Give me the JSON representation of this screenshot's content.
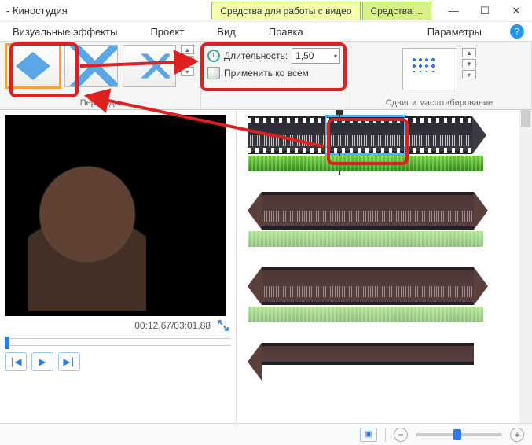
{
  "titlebar": {
    "app_title": "- Киностудия",
    "context_tab_1": "Средства для работы с видео",
    "context_tab_2": "Средства ...",
    "min_glyph": "—",
    "max_glyph": "☐",
    "close_glyph": "✕",
    "help_glyph": "?"
  },
  "menu": {
    "visual_effects": "Визуальные эффекты",
    "project": "Проект",
    "view": "Вид",
    "edit": "Правка",
    "params": "Параметры"
  },
  "ribbon": {
    "transitions_label": "Переходы",
    "duration_label": "Длительность:",
    "duration_value": "1,50",
    "apply_all_label": "Применить ко всем",
    "panzoom_label": "Сдвиг и масштабирование",
    "updown_up": "▲",
    "updown_down": "▼",
    "dropdown_glyph": "▾"
  },
  "preview": {
    "timecode": "00:12,67/03:01,88"
  },
  "playback": {
    "prev_glyph": "∣◀",
    "play_glyph": "▶",
    "next_glyph": "▶∣"
  },
  "status": {
    "view_glyph": "▣",
    "minus_glyph": "−",
    "plus_glyph": "+"
  }
}
